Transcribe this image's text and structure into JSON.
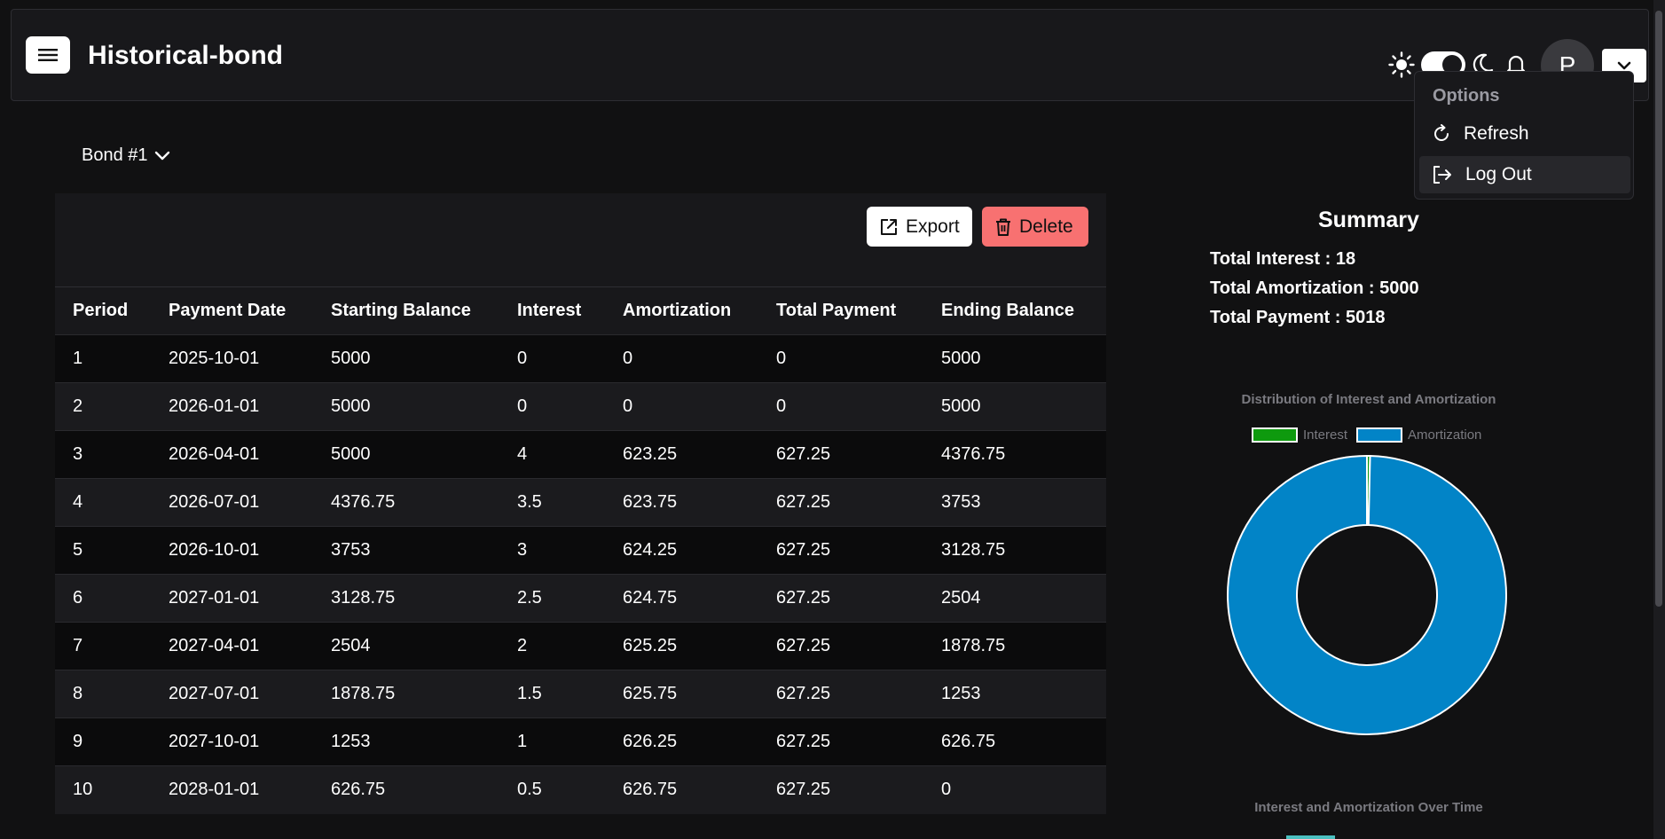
{
  "header": {
    "title": "Historical-bond",
    "avatar_letter": "P",
    "theme_mode": "dark"
  },
  "options_menu": {
    "title": "Options",
    "items": [
      {
        "label": "Refresh",
        "icon": "refresh-icon"
      },
      {
        "label": "Log Out",
        "icon": "logout-icon"
      }
    ]
  },
  "bond_select": {
    "label": "Bond #1"
  },
  "actions": {
    "export_label": "Export",
    "delete_label": "Delete",
    "delete_color": "#f87171"
  },
  "table": {
    "columns": [
      "Period",
      "Payment Date",
      "Starting Balance",
      "Interest",
      "Amortization",
      "Total Payment",
      "Ending Balance"
    ],
    "rows": [
      [
        "1",
        "2025-10-01",
        "5000",
        "0",
        "0",
        "0",
        "5000"
      ],
      [
        "2",
        "2026-01-01",
        "5000",
        "0",
        "0",
        "0",
        "5000"
      ],
      [
        "3",
        "2026-04-01",
        "5000",
        "4",
        "623.25",
        "627.25",
        "4376.75"
      ],
      [
        "4",
        "2026-07-01",
        "4376.75",
        "3.5",
        "623.75",
        "627.25",
        "3753"
      ],
      [
        "5",
        "2026-10-01",
        "3753",
        "3",
        "624.25",
        "627.25",
        "3128.75"
      ],
      [
        "6",
        "2027-01-01",
        "3128.75",
        "2.5",
        "624.75",
        "627.25",
        "2504"
      ],
      [
        "7",
        "2027-04-01",
        "2504",
        "2",
        "625.25",
        "627.25",
        "1878.75"
      ],
      [
        "8",
        "2027-07-01",
        "1878.75",
        "1.5",
        "625.75",
        "627.25",
        "1253"
      ],
      [
        "9",
        "2027-10-01",
        "1253",
        "1",
        "626.25",
        "627.25",
        "626.75"
      ],
      [
        "10",
        "2028-01-01",
        "626.75",
        "0.5",
        "626.75",
        "627.25",
        "0"
      ]
    ]
  },
  "summary": {
    "title": "Summary",
    "total_interest": "Total Interest : 18",
    "total_amortization": "Total Amortization : 5000",
    "total_payment": "Total Payment : 5018"
  },
  "chart_data": {
    "type": "pie",
    "title": "Distribution of Interest and Amortization",
    "categories": [
      "Interest",
      "Amortization"
    ],
    "values": [
      18,
      5000
    ],
    "colors": [
      "#0e9a0e",
      "#0284c7"
    ],
    "legend": "top"
  },
  "second_chart": {
    "title": "Interest and Amortization Over Time"
  }
}
